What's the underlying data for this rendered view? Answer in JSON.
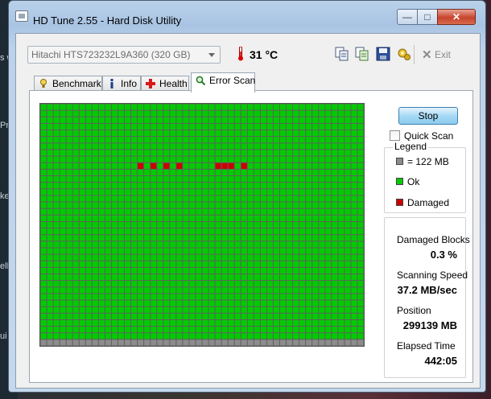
{
  "window": {
    "title": "HD Tune 2.55 - Hard Disk Utility",
    "buttons": {
      "minimize": "—",
      "maximize": "□",
      "close": "✕"
    }
  },
  "toolbar": {
    "drive": "Hitachi HTS723232L9A360 (320 GB)",
    "temperature": "31 °C",
    "exit_label": "Exit",
    "icons": [
      "copy-icon",
      "copy-info-icon",
      "save-icon",
      "options-icon",
      "exit-icon",
      "thermometer-icon"
    ]
  },
  "tabs": [
    {
      "label": "Benchmark",
      "icon": "benchmark-icon",
      "active": false
    },
    {
      "label": "Info",
      "icon": "info-icon",
      "active": false
    },
    {
      "label": "Health",
      "icon": "health-icon",
      "active": false
    },
    {
      "label": "Error Scan",
      "icon": "magnifier-icon",
      "active": true
    }
  ],
  "error_scan": {
    "stop_label": "Stop",
    "quick_scan_label": "Quick Scan",
    "quick_scan_checked": false,
    "legend": {
      "title": "Legend",
      "block_size": "= 122 MB",
      "ok": "Ok",
      "damaged": "Damaged"
    },
    "stats": {
      "damaged_blocks_label": "Damaged Blocks",
      "damaged_blocks_value": "0.3 %",
      "scanning_speed_label": "Scanning Speed",
      "scanning_speed_value": "37.2 MB/sec",
      "position_label": "Position",
      "position_value": "299139 MB",
      "elapsed_time_label": "Elapsed Time",
      "elapsed_time_value": "442:05"
    },
    "block_map": {
      "columns": 50,
      "rows": 37,
      "damaged_cells": [
        [
          9,
          15
        ],
        [
          9,
          17
        ],
        [
          9,
          19
        ],
        [
          9,
          21
        ],
        [
          9,
          27
        ],
        [
          9,
          28
        ],
        [
          9,
          29
        ],
        [
          9,
          31
        ]
      ],
      "unscanned_rows": [
        36
      ]
    },
    "colors": {
      "ok": "#00cc00",
      "damaged": "#cc0000",
      "unscanned": "#8c8c8c",
      "grid_line": "#555555"
    }
  },
  "background_fragments": [
    "s w",
    "Pru",
    "ke",
    "elD",
    "ui"
  ]
}
